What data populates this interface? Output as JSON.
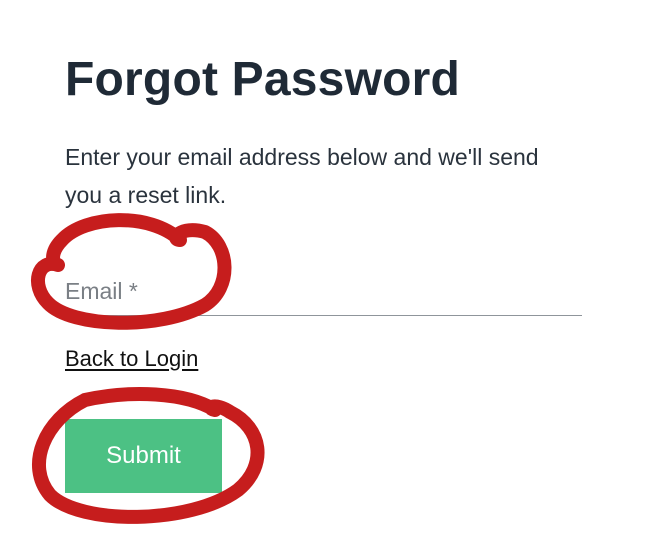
{
  "form": {
    "title": "Forgot Password",
    "description": "Enter your email address below and we'll send you a reset link.",
    "email_placeholder": "Email *",
    "email_value": "",
    "back_link_label": "Back to Login",
    "submit_label": "Submit"
  },
  "colors": {
    "title_text": "#1f2a36",
    "submit_background": "#4cc184",
    "annotation_marker": "#c61d1d"
  }
}
